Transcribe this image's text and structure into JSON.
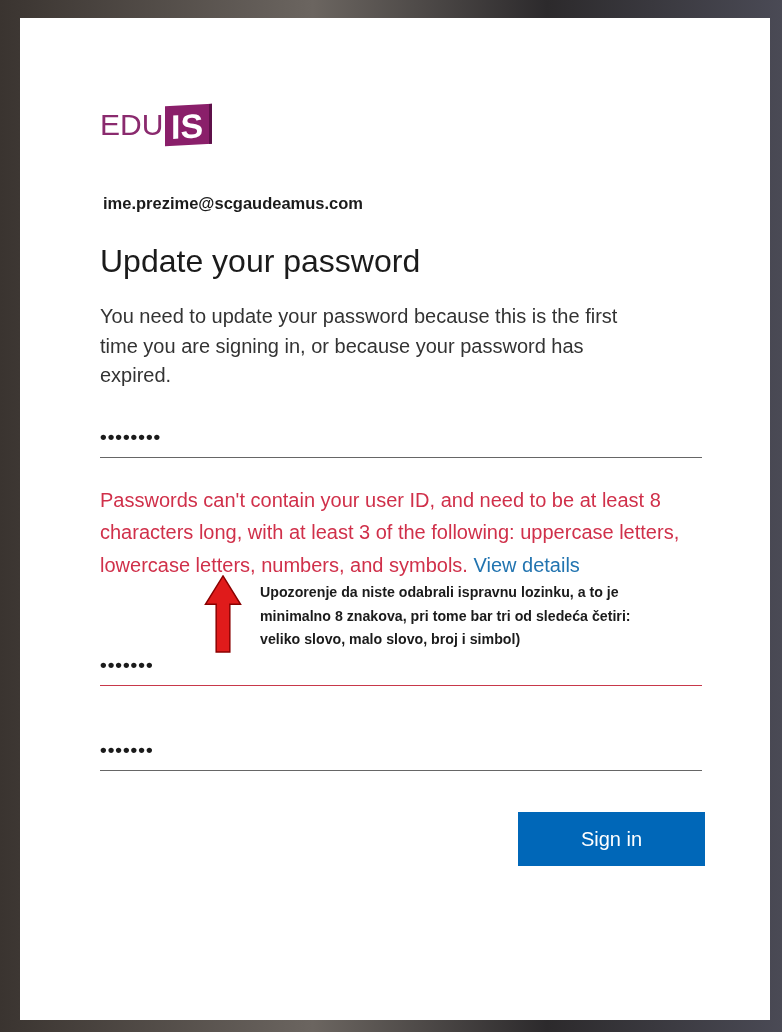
{
  "logo": {
    "text": "EDU",
    "badge": "IS"
  },
  "account": "ime.prezime@scgaudeamus.com",
  "title": "Update your password",
  "description": "You need to update your password because this is the first time you are signing in, or because your password has expired.",
  "fields": [
    {
      "kind": "password",
      "value": "••••••••",
      "error": false
    },
    {
      "kind": "message",
      "text": "Passwords can't contain your user ID, and need to be at least 8 characters long, with at least 3 of the following: uppercase letters, lowercase letters, numbers, and symbols.",
      "link": "View details"
    },
    {
      "kind": "password",
      "value": "•••••••",
      "error": true
    },
    {
      "kind": "password",
      "value": "•••••••",
      "error": false
    }
  ],
  "annotation": "Upozorenje da niste odabrali ispravnu lozinku, a to je minimalno 8 znakova, pri tome  bar tri od sledeća četiri: veliko slovo, malo slovo, broj i simbol)",
  "button": "Sign in"
}
